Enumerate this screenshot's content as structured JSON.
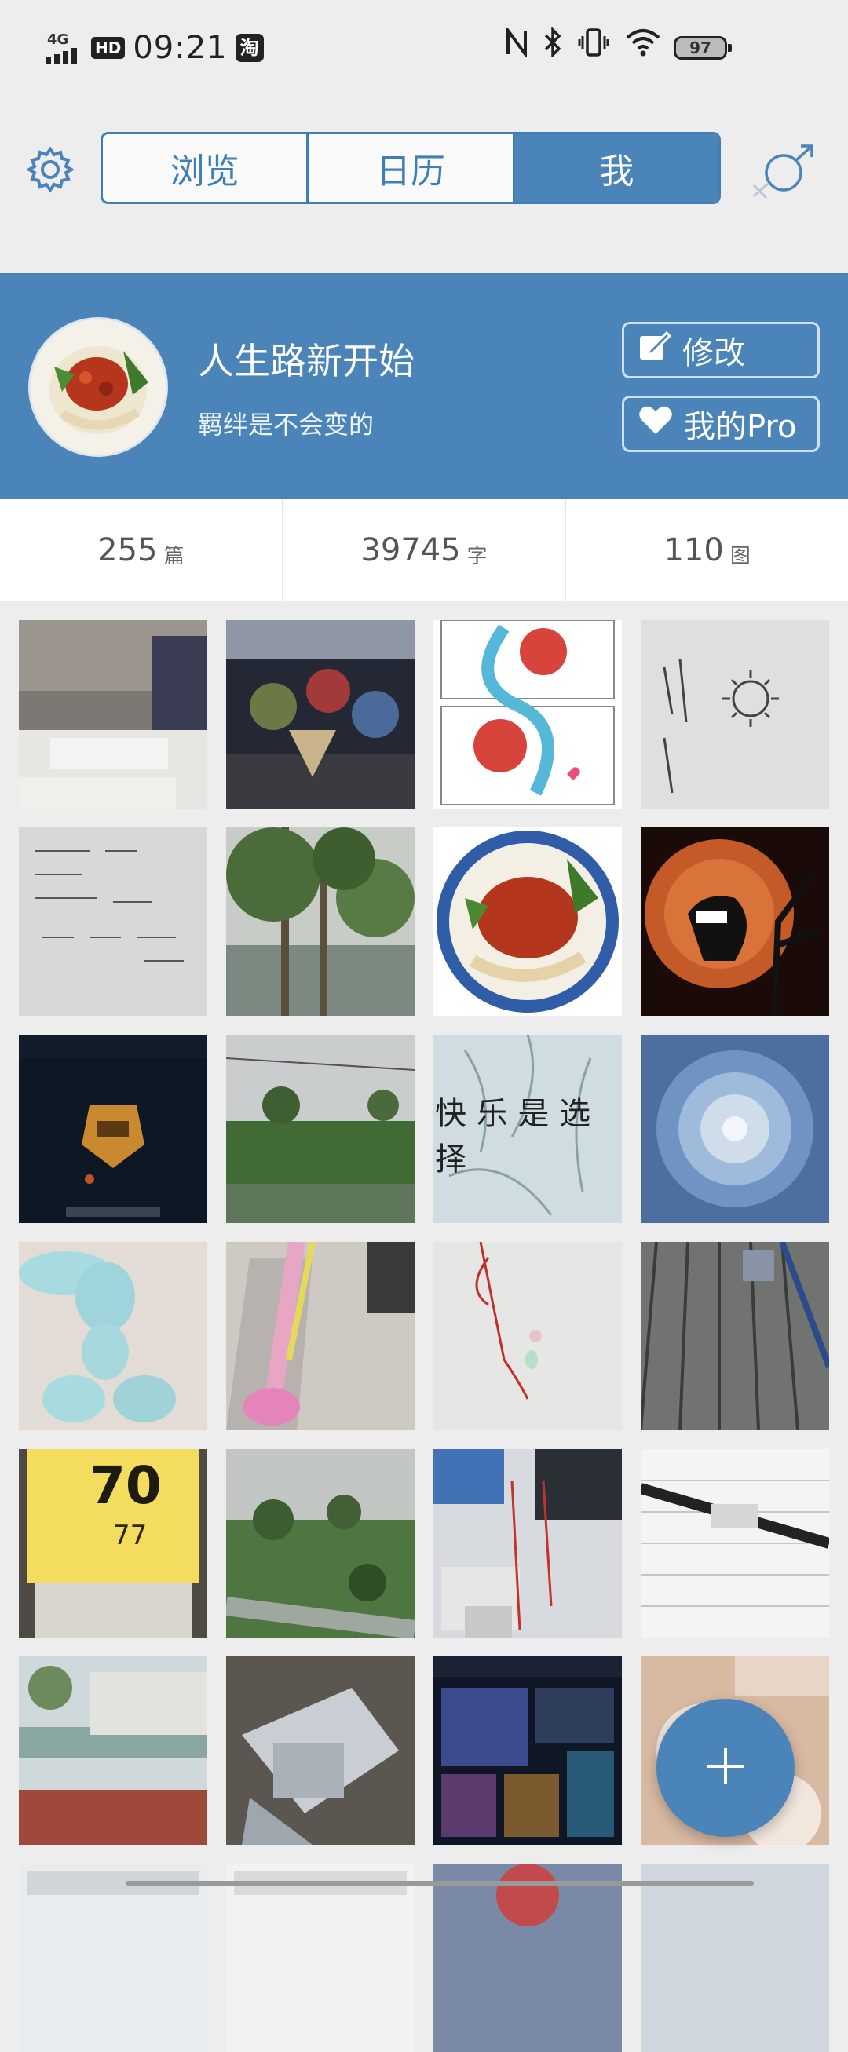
{
  "status_bar": {
    "network": "4G",
    "hd": "HD",
    "time": "09:21",
    "app_badge": "淘",
    "battery": "97"
  },
  "nav": {
    "tabs": [
      {
        "label": "浏览",
        "active": false
      },
      {
        "label": "日历",
        "active": false
      },
      {
        "label": "我",
        "active": true
      }
    ]
  },
  "profile": {
    "name": "人生路新开始",
    "signature": "羁绊是不会变的",
    "edit_label": "修改",
    "pro_label": "我的Pro"
  },
  "stats": [
    {
      "value": "255",
      "unit": "篇"
    },
    {
      "value": "39745",
      "unit": "字"
    },
    {
      "value": "110",
      "unit": "图"
    }
  ],
  "photo_texts": {
    "happy_choice": "快 乐 是 选 择",
    "meter_top": "70",
    "meter_bottom": "77"
  },
  "colors": {
    "accent": "#4a84b9",
    "background": "#ededed"
  },
  "icons": [
    "settings-gear-icon",
    "gender-icon",
    "edit-icon",
    "heart-icon",
    "add-icon"
  ]
}
